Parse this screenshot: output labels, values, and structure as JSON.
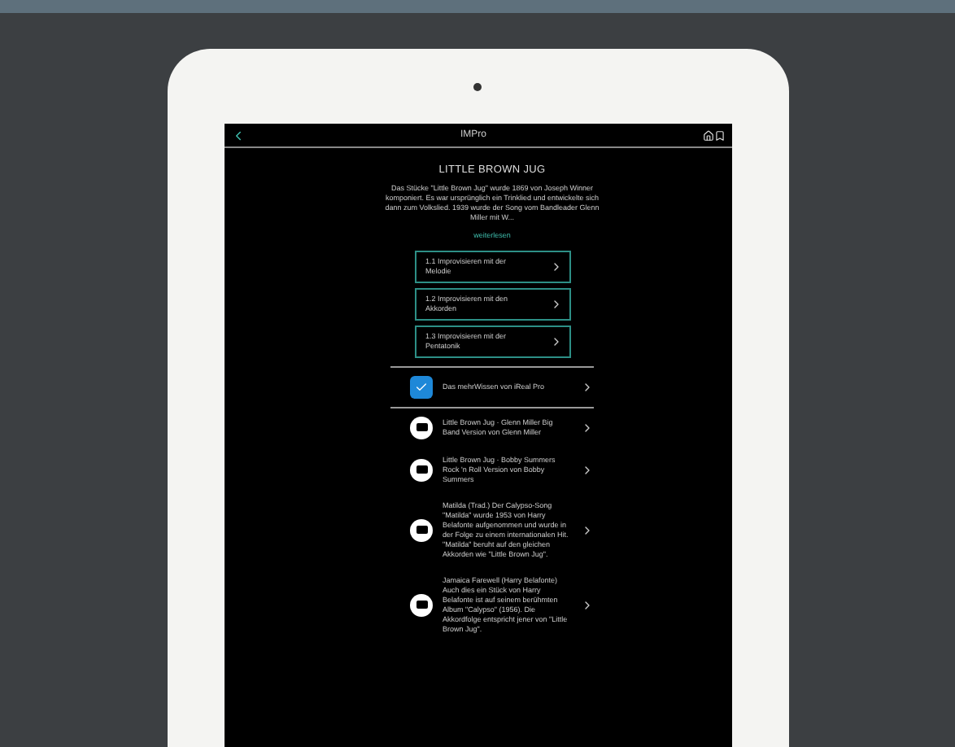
{
  "app_bar": {
    "title": "IMPro"
  },
  "song": {
    "title": "LITTLE BROWN JUG",
    "description": "Das Stücke \"Little Brown Jug\" wurde 1869 von Joseph Winner komponiert. Es war ursprünglich ein Trinklied und entwickelte sich dann zum Volkslied. 1939 wurde der Song vom Bandleader Glenn Miller mit W...",
    "more_link": "weiterlesen"
  },
  "lessons": [
    {
      "label": "1.1 Improvisieren mit der Melodie"
    },
    {
      "label": "1.2 Improvisieren mit den Akkorden"
    },
    {
      "label": "1.3 Improvisieren mit der Pentatonik"
    }
  ],
  "links": [
    {
      "kind": "app",
      "text": "Das mehrWissen von iReal Pro"
    },
    {
      "kind": "video",
      "text": "Little Brown Jug · Glenn Miller Big Band Version von Glenn Miller"
    },
    {
      "kind": "video",
      "text": "Little Brown Jug · Bobby Summers Rock 'n Roll Version von Bobby Summers"
    },
    {
      "kind": "video",
      "text": "Matilda (Trad.) Der Calypso-Song \"Matilda\" wurde 1953 von Harry Belafonte aufgenommen und wurde in der Folge zu einem internationalen Hit. \"Matilda\" beruht auf den gleichen Akkorden wie \"Little Brown Jug\"."
    },
    {
      "kind": "video",
      "text": "Jamaica Farewell (Harry Belafonte) Auch dies ein Stück von Harry Belafonte ist auf seinem berühmten Album \"Calypso\" (1956). Die Akkordfolge entspricht jener von \"Little Brown Jug\"."
    }
  ]
}
